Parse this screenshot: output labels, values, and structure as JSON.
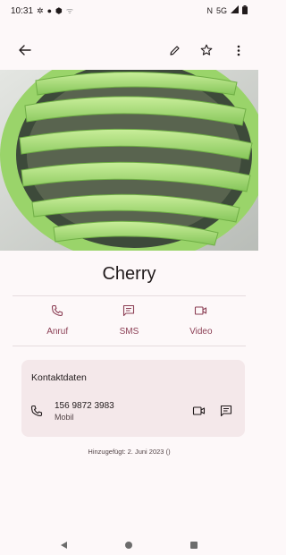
{
  "status_bar": {
    "time": "10:31",
    "left_icons": [
      "settings-icon",
      "chat-icon",
      "shield-icon",
      "signal-icon"
    ],
    "network": "5G",
    "right_icons": [
      "nfc-icon",
      "signal-bars-icon",
      "battery-icon"
    ]
  },
  "app_bar": {
    "back_icon": "arrow-back-icon",
    "edit_icon": "pencil-icon",
    "favorite_icon": "star-icon",
    "more_icon": "more-vert-icon"
  },
  "contact": {
    "name": "Cherry"
  },
  "actions": [
    {
      "label": "Anruf",
      "icon": "phone-icon"
    },
    {
      "label": "SMS",
      "icon": "message-icon"
    },
    {
      "label": "Video",
      "icon": "video-icon"
    }
  ],
  "contact_details": {
    "title": "Kontaktdaten",
    "phone": {
      "number": "156 9872 3983",
      "type": "Mobil"
    }
  },
  "added_text": "Hinzugefügt: 2. Juni 2023 ()",
  "colors": {
    "accent": "#8c3f55",
    "background": "#fdf8f9",
    "card": "#f4e8ea",
    "text": "#201a1b"
  }
}
